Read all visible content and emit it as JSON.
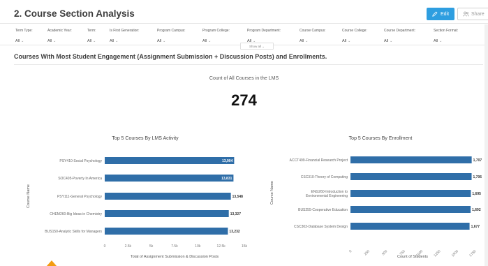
{
  "page": {
    "title": "2. Course Section Analysis",
    "edit_label": "Edit",
    "share_label": "Share"
  },
  "filters": [
    {
      "label": "Term Type:",
      "value": "All"
    },
    {
      "label": "Academic Year:",
      "value": "All"
    },
    {
      "label": "Term:",
      "value": "All"
    },
    {
      "label": "Is First Generation:",
      "value": "All"
    },
    {
      "label": "Program Campus:",
      "value": "All"
    },
    {
      "label": "Program College:",
      "value": "All"
    },
    {
      "label": "Program Department:",
      "value": "All"
    },
    {
      "label": "Course Campus:",
      "value": "All"
    },
    {
      "label": "Course College:",
      "value": "All"
    },
    {
      "label": "Course Department:",
      "value": "All"
    },
    {
      "label": "Section Format:",
      "value": "All"
    }
  ],
  "show_all_label": "Show all",
  "section": {
    "heading": "Courses With Most Student Engagement (Assignment Submission + Discussion Posts) and Enrollments."
  },
  "kpi": {
    "label": "Count of All Courses in the LMS",
    "value": "274"
  },
  "chart_data": [
    {
      "type": "bar",
      "orientation": "horizontal",
      "title": "Top 5 Courses By LMS Activity",
      "categories": [
        "PSY410-Social Psychology",
        "SOC405-Poverty In America",
        "PSY111-General Psychology",
        "CHEM260-Big Ideas in Chemistry",
        "BUS150-Analytic Skills for Managers"
      ],
      "values": [
        13904,
        13831,
        13548,
        13327,
        13232
      ],
      "value_labels": [
        "13,904",
        "13,831",
        "13,548",
        "13,327",
        "13,232"
      ],
      "xlabel": "Total of Assignment Submission & Discussion Posts",
      "ylabel": "Course Name",
      "xlim": [
        0,
        15000
      ],
      "ticks": [
        "0",
        "2.5k",
        "5k",
        "7.5k",
        "10k",
        "12.5k",
        "15k"
      ],
      "color": "#2f6ea8"
    },
    {
      "type": "bar",
      "orientation": "horizontal",
      "title": "Top 5 Courses By Enrollment",
      "categories": [
        "ACCT499-Financial Research Project",
        "CSC310-Theory of Computing",
        "ENG260-Introduction to Environmental Engineering",
        "BUS255-Cooperative Education",
        "CSC303-Database System Design"
      ],
      "values": [
        1707,
        1706,
        1695,
        1692,
        1677
      ],
      "value_labels": [
        "1,707",
        "1,706",
        "1,695",
        "1,692",
        "1,677"
      ],
      "xlabel": "Count of Students",
      "ylabel": "Course Name",
      "xlim": [
        0,
        1750
      ],
      "ticks": [
        "0",
        "250",
        "500",
        "750",
        "1000",
        "1250",
        "1500",
        "1750"
      ],
      "color": "#2f6ea8"
    }
  ]
}
